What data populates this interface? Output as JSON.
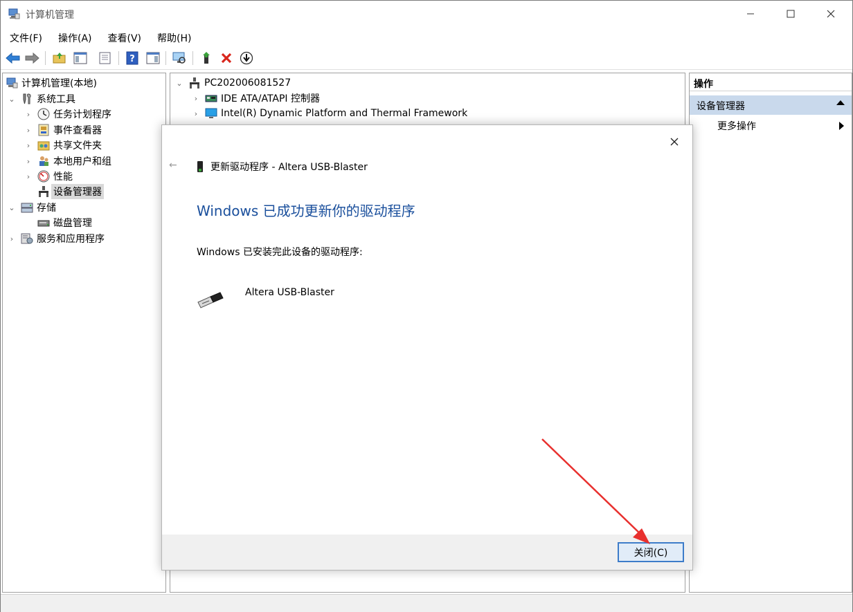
{
  "window": {
    "title": "计算机管理",
    "controls": {
      "minimize": "minimize-icon",
      "maximize": "maximize-icon",
      "close": "close-icon"
    }
  },
  "menubar": {
    "items": [
      {
        "label": "文件(F)"
      },
      {
        "label": "操作(A)"
      },
      {
        "label": "查看(V)"
      },
      {
        "label": "帮助(H)"
      }
    ]
  },
  "toolbar": {
    "icons": [
      "back-arrow-icon",
      "forward-arrow-icon",
      "up-folder-icon",
      "show-hide-tree-icon",
      "export-list-icon",
      "help-icon",
      "show-action-pane-icon",
      "scan-hardware-icon",
      "enable-device-icon",
      "uninstall-device-icon",
      "update-driver-icon"
    ]
  },
  "left_tree": {
    "items": [
      {
        "label": "计算机管理(本地)"
      },
      {
        "label": "系统工具"
      },
      {
        "label": "任务计划程序"
      },
      {
        "label": "事件查看器"
      },
      {
        "label": "共享文件夹"
      },
      {
        "label": "本地用户和组"
      },
      {
        "label": "性能"
      },
      {
        "label": "设备管理器"
      },
      {
        "label": "存储"
      },
      {
        "label": "磁盘管理"
      },
      {
        "label": "服务和应用程序"
      }
    ]
  },
  "device_tree": {
    "root": "PC202006081527",
    "items": [
      {
        "label": "IDE ATA/ATAPI 控制器"
      },
      {
        "label": "Intel(R) Dynamic Platform and Thermal Framework"
      }
    ]
  },
  "actions_pane": {
    "header": "操作",
    "section": "设备管理器",
    "more": "更多操作"
  },
  "dialog": {
    "back": "←",
    "header": "更新驱动程序 - Altera USB-Blaster",
    "title": "Windows 已成功更新你的驱动程序",
    "description": "Windows 已安装完此设备的驱动程序:",
    "device_name": "Altera USB-Blaster",
    "close_button": "关闭(C)"
  },
  "colors": {
    "dialog_title": "#1a4f9c",
    "action_section_bg": "#c9d9ec",
    "button_border": "#3d7cc9",
    "annotation_arrow": "#e8302e"
  }
}
